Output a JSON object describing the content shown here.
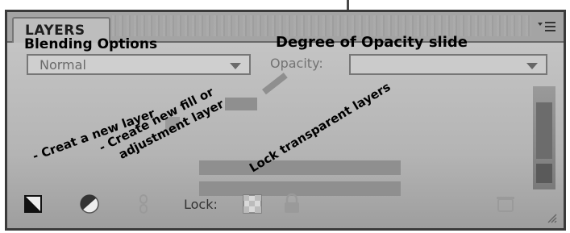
{
  "panel": {
    "tab_title": "LAYERS",
    "menu_icon": "panel-menu-icon"
  },
  "blend_mode": {
    "selected": "Normal"
  },
  "opacity": {
    "label": "Opacity:",
    "value": ""
  },
  "annotations": {
    "blending": "Blending Options",
    "opacity": "Degree of Opacity slide",
    "new_layer": "- Creat a new layer",
    "new_fill_line1": "- Create new fill or",
    "new_fill_line2": "adjustment layer",
    "lock_transparent": "Lock transparent layers"
  },
  "footer": {
    "lock_label": "Lock:",
    "icons": [
      "new-layer-icon",
      "fill-adjustment-icon",
      "link-icon",
      "lock-transparent-icon",
      "lock-all-icon",
      "trash-icon"
    ]
  },
  "colors": {
    "panel_bg": "#bdbdbd",
    "border": "#3a3a3a",
    "annotation_text": "#000000"
  }
}
